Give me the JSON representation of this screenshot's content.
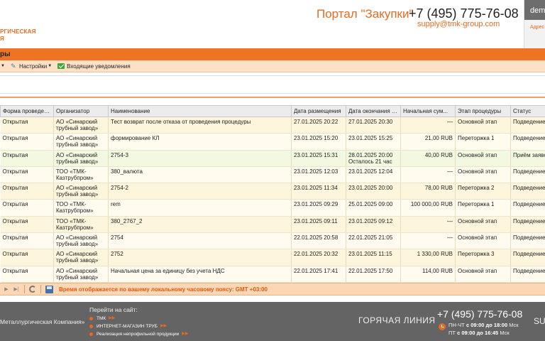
{
  "header": {
    "logo_line1": "РГИЧЕСКАЯ",
    "logo_line2": "Я",
    "portal_title": "Портал \"Закупки\"",
    "phone": "+7 (495) 775-76-08",
    "email": "supply@tmk-group.com",
    "user_name": "demo",
    "user_address_label": "Адрес"
  },
  "titlebar": {
    "label": "ры"
  },
  "toolbar": {
    "settings_label": "Настройки",
    "notifications_label": "Входящие уведомления"
  },
  "table": {
    "columns": [
      "Форма проведения",
      "Организатор",
      "Наименование",
      "Дата размещения",
      "Дата окончания п...",
      "Начальная сум...",
      "Этап процедуры",
      "Статус"
    ],
    "rows": [
      [
        "Открытая",
        "АО «Синарский трубный завод»",
        "Тест возврат после отказа от проведения процедуры",
        "27.01.2025 20:22",
        "27.01.2025 20:30",
        "—",
        "Основной этап",
        "Подведение"
      ],
      [
        "Открытая",
        "АО «Синарский трубный завод»",
        "формирование КЛ",
        "23.01.2025 15:20",
        "23.01.2025 15:25",
        "21,00 RUB",
        "Переторжка 1",
        "Подведение"
      ],
      [
        "Открытая",
        "АО «Синарский трубный завод»",
        "2754-3",
        "23.01.2025 15:31",
        "28.01.2025 20:00\nОсталось 21 час",
        "40,00 RUB",
        "Основной этап",
        "Приём заявок"
      ],
      [
        "Открытая",
        "ТОО «ТМК-Казтрубпром»",
        "380_валюта",
        "23.01.2025 12:03",
        "23.01.2025 12:04",
        "—",
        "Основной этап",
        "Подведение"
      ],
      [
        "Открытая",
        "АО «Синарский трубный завод»",
        "2754-2",
        "23.01.2025 11:34",
        "23.01.2025 20:00",
        "78,00 RUB",
        "Переторжка 2",
        "Подведение"
      ],
      [
        "Открытая",
        "ТОО «ТМК-Казтрубпром»",
        "rem",
        "23.01.2025 09:29",
        "25.01.2025 09:00",
        "100 000,00 RUB",
        "Переторжка 1",
        "Подведение"
      ],
      [
        "Открытая",
        "ТОО «ТМК-Казтрубпром»",
        "380_2767_2",
        "23.01.2025 09:11",
        "23.01.2025 09:12",
        "—",
        "Основной этап",
        "Подведение"
      ],
      [
        "Открытая",
        "АО «Синарский трубный завод»",
        "2754",
        "22.01.2025 20:58",
        "22.01.2025 21:05",
        "—",
        "Основной этап",
        "Подведение"
      ],
      [
        "Открытая",
        "АО «Синарский трубный завод»",
        "2752",
        "22.01.2025 20:32",
        "23.01.2025 11:15",
        "1 330,00 RUB",
        "Переторжка 3",
        "Подведение"
      ],
      [
        "Открытая",
        "АО «Синарский трубный завод»",
        "Начальная цена за единицу без учета НДС",
        "22.01.2025 17:41",
        "22.01.2025 17:50",
        "114,00 RUB",
        "Основной этап",
        "Подведение"
      ]
    ]
  },
  "pager": {
    "tz_note": "Время отображается по вашему локальному часовому поясу: GMT +03:00"
  },
  "footer": {
    "company": "Металлургическая Компания»",
    "go_to_site": "Перейти на сайт:",
    "links": [
      "ТМК",
      "ИНТЕРНЕТ-МАГАЗИН ТРУБ",
      "Реализация непрофильной продукции"
    ],
    "hotline": "ГОРЯЧАЯ ЛИНИЯ",
    "phone": "+7 (495) 775-76-08",
    "sched1_days": "ПН-ЧТ",
    "sched1_time": "с 09:00 до 18:00",
    "sched1_tz": "Мск",
    "sched2_days": "ПТ",
    "sched2_time": "с 09:00 до 16:45",
    "sched2_tz": "Мск",
    "sub": "SU"
  },
  "colors": {
    "accent": "#ee7424",
    "footer_bg": "#646464",
    "toolbar_bg": "#fde1c6"
  }
}
